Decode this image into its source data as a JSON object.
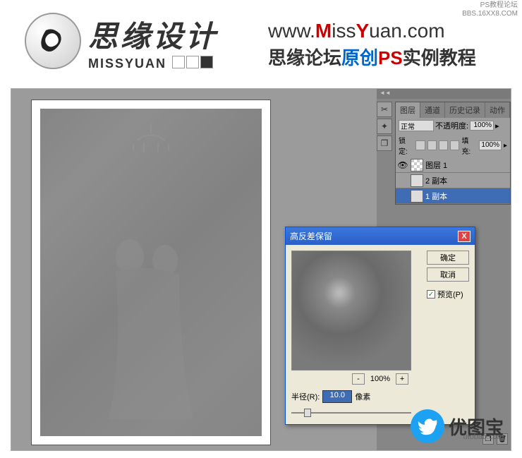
{
  "header": {
    "cn_title": "思缘设计",
    "en_title": "MISSYUAN",
    "url_prefix": "www.",
    "url_m": "M",
    "url_mid1": "iss",
    "url_y": "Y",
    "url_mid2": "uan",
    "url_suffix": ".com",
    "subtitle_a": "思缘论坛",
    "subtitle_b": "原创",
    "subtitle_c": "PS",
    "subtitle_d": "实例教程"
  },
  "watermark_tr": {
    "line1": "PS教程论坛",
    "line2": "BBS.16XX8.COM"
  },
  "dialog": {
    "title": "高反差保留",
    "ok": "确定",
    "cancel": "取消",
    "preview_label": "预览(P)",
    "zoom_minus": "-",
    "zoom_pct": "100%",
    "zoom_plus": "+",
    "radius_label": "半径(R):",
    "radius_value": "10.0",
    "radius_unit": "像素",
    "close": "X"
  },
  "panels": {
    "tabs": {
      "layers": "图层",
      "channels": "通道",
      "history": "历史记录",
      "actions": "动作"
    },
    "blend_mode": "正常",
    "opacity_label": "不透明度:",
    "opacity_value": "100%",
    "lock_label": "锁定:",
    "fill_label": "填充:",
    "fill_value": "100%",
    "layers": [
      {
        "name": "图层 1",
        "selected": false
      },
      {
        "name": "2 副本",
        "selected": false
      },
      {
        "name": "1 副本",
        "selected": true
      }
    ]
  },
  "watermark_br": {
    "text": "优图宝",
    "sub": "utobao.com"
  }
}
